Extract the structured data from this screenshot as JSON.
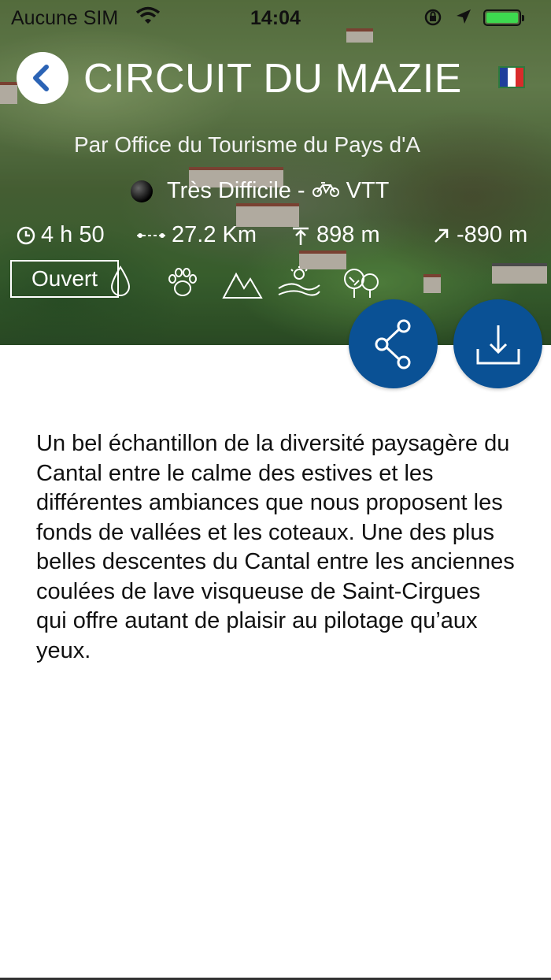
{
  "status_bar": {
    "carrier": "Aucune SIM",
    "time": "14:04"
  },
  "header": {
    "title": "CIRCUIT DU MAZIE",
    "author": "Par Office du Tourisme du Pays d'A",
    "difficulty": "Très Difficile",
    "separator": "-",
    "activity": "VTT",
    "language_flag": "fr-flag-icon"
  },
  "stats": {
    "duration": "4 h 50",
    "distance": "27.2 Km",
    "ascent": "898 m",
    "descent": "-890 m"
  },
  "status_badge": "Ouvert",
  "themes": [
    "water-drop-icon",
    "paw-print-icon",
    "mountains-icon",
    "landscape-icon",
    "trees-icon"
  ],
  "actions": [
    "share-button",
    "download-button"
  ],
  "colors": {
    "accent": "#0a5195",
    "battery": "#3dd94f",
    "back_arrow": "#2b63b5"
  },
  "description": "Un bel échantillon de la diversité paysagère du Cantal entre le calme des estives et les différentes ambiances que nous proposent les fonds de vallées et les coteaux. Une des plus belles descentes du Cantal entre les anciennes coulées de lave visqueuse de Saint-Cirgues qui offre autant de plaisir au pilotage qu’aux yeux."
}
